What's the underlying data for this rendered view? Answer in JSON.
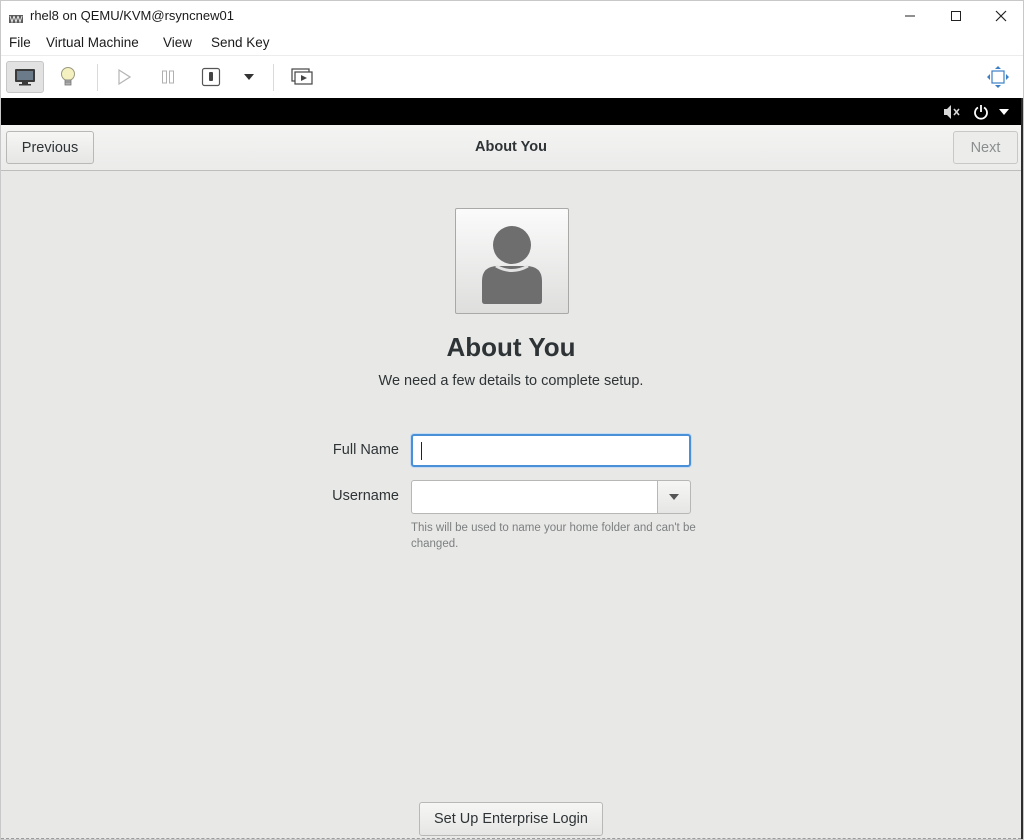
{
  "window": {
    "title": "rhel8 on QEMU/KVM@rsyncnew01",
    "app_icon": "virt-manager-icon",
    "controls": [
      "minimize-icon",
      "maximize-icon",
      "close-icon"
    ]
  },
  "menubar": {
    "items": [
      "File",
      "Virtual Machine",
      "View",
      "Send Key"
    ]
  },
  "toolbar": {
    "buttons": [
      {
        "icon": "console-icon",
        "active": true
      },
      {
        "icon": "details-lightbulb-icon",
        "active": false
      },
      {
        "icon": "run-icon",
        "active": false
      },
      {
        "icon": "pause-icon",
        "active": false
      },
      {
        "icon": "shutdown-icon",
        "active": false
      },
      {
        "icon": "shutdown-dropdown-icon",
        "active": false
      },
      {
        "icon": "snapshots-icon",
        "active": false
      },
      {
        "icon": "fullscreen-icon",
        "active": false
      }
    ]
  },
  "guest": {
    "topbar": {
      "icons": [
        "audio-muted-icon",
        "power-icon",
        "chevron-down-icon"
      ]
    },
    "header": {
      "previous_label": "Previous",
      "title": "About You",
      "next_label": "Next"
    },
    "page": {
      "avatar_icon": "user-avatar-icon",
      "title": "About You",
      "subtitle": "We need a few details to complete setup.",
      "fullname_label": "Full Name",
      "fullname_value": "",
      "username_label": "Username",
      "username_value": "",
      "username_hint": "This will be used to name your home folder and can't be changed.",
      "enterprise_label": "Set Up Enterprise Login"
    }
  },
  "colors": {
    "focus_ring": "#4a90d9",
    "guest_background": "#e8e8e7",
    "topbar": "#000000"
  }
}
